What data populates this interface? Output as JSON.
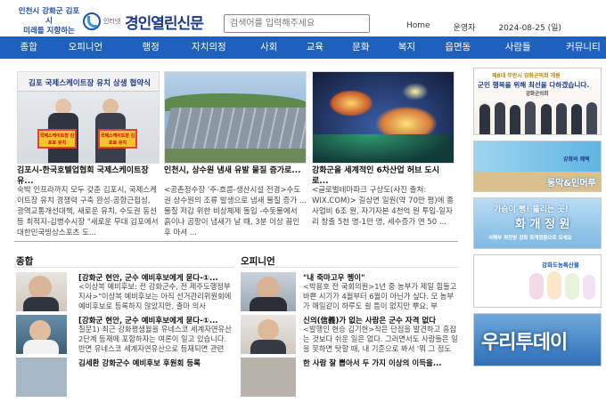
{
  "header": {
    "slogan_line1": "인천시 강화군 김포시",
    "slogan_line2": "미래를 지향하는",
    "brand_prefix": "인터넷",
    "brand_name": "경인열린신문",
    "search_placeholder": "검색어를 입력해주세요",
    "links": [
      "Home",
      "운영자",
      "2024-08-25 (일)"
    ]
  },
  "nav": {
    "items": [
      "종합",
      "오피니언",
      "행정",
      "자치의정",
      "사회",
      "교육",
      "문화",
      "복지",
      "읍면동",
      "사람들",
      "커뮤니티"
    ]
  },
  "features": [
    {
      "title": "김포시-한국호텔업협회 국제스케이트장 유...",
      "desc": "숙박 인프라까지 모두 갖춘 김포시, 국제스케이트장 유치 경쟁력 구축 완성-공항근접성, 광역교통개선대책, 새로운 유치, 수도권 동선 등 최적지-김병수시장 \"새로운 무대 김포에서 대한민국빙상스포츠 도...",
      "image_caption": "김포 국제스케이트장 유치 상생 협약식",
      "sign_text": "국제스케이트장 김포로 유치",
      "sign_text2": "국제스케이트장 김포로 유치"
    },
    {
      "title": "인천시, 상수원 냄새 유발 물질 증가로...",
      "desc": "<공촌정수장 '주-흐름-생산시설 전경>수도권 상수원의 조류 발생으로 냄새 물질 증가 ... 물질 저감 위한 비상체제 돌입 -수돗물에서 흙이나 곰팡이 냄새가 날 때, 3분 이상 끓인 후 마셔 ..."
    },
    {
      "title": "강화군을 세계적인 6차산업 허브 도시로...",
      "desc": "<글로벌테마파크 구상도(사진 출처: WIX.COM)> 길상면 일원(약 70만 평)에 종사업비 6조 원, 자기자본 4천억 원 투입-일자리 창출 5천 명-1만 명, 세수증가 연 50 ..."
    }
  ],
  "sections": {
    "left_title": "종합",
    "right_title": "오피니언"
  },
  "left_rows": [
    {
      "title": "[강화군 현안, 군수 예비후보에게 묻다-①...",
      "desc": "<이상복 예비후보: 전 강화군수, 전 제주도행정부지사>\"이상복 예비후보는 아직 선거관리위원회에 예비후보로 등록하지 않았지만, 출마 의사"
    },
    {
      "title": "[강화군 현안, 군수 예비후보에게 묻다-①...",
      "desc": "질문1) 최근 강화평생월을 유네스코 세계자연유산 2단계 등재에 포함하자는 여론이 일고 있습니다. 반면 유네스코 세계자연유산으로 등재되면 관련"
    },
    {
      "title": "김세환 강화군수 예비후보 후원회 등록",
      "desc": ""
    }
  ],
  "right_rows": [
    {
      "title": "\"내 죽마고우 펭이\"",
      "desc": "<박용호 전 국회의원>1년 중 농부가 제일 힘들고 바쁜 시기가 4월부터 6월이 아닌가 싶다. 모 농부가 매일같이 하루도 쉴 틈이 없지만 뿌요, 부"
    },
    {
      "title": "신의(信義)가 없는 사람은 군수 자격 없다",
      "desc": "<발행인 현승 김기현>작은 단점을 발견하고 흠잡는 것보다 쉬운 일은 없다. 그러면서도 사람들은 일을 못하면 탓할 때, 내 기준으로 봐서 '뭐 그 정도"
    },
    {
      "title": "한 사람 잘 뽑아서 두 가지 이상의 이득을...",
      "desc": ""
    }
  ],
  "banners": [
    {
      "text1": "제8대 무안시 강화군의회 개원",
      "text2": "군민 행복을 위해 최선을 다하겠습니다.",
      "text3": "강화군의회"
    },
    {
      "text1": "강화의 혜택",
      "text2": "동막&민머루"
    },
    {
      "text1": "가슴이 뻥! 뚫리는 곳!",
      "text2": "화 개 정 원",
      "text3": "서해부 최전방 강화 화개정원으로 오세요"
    },
    {
      "text1": "강화도농특산물"
    },
    {
      "text1": "우리투데이"
    }
  ],
  "colors": {
    "nav_bg": "#1f5fbd",
    "brand": "#1c3a8c",
    "accent": "#2a9bd8"
  }
}
